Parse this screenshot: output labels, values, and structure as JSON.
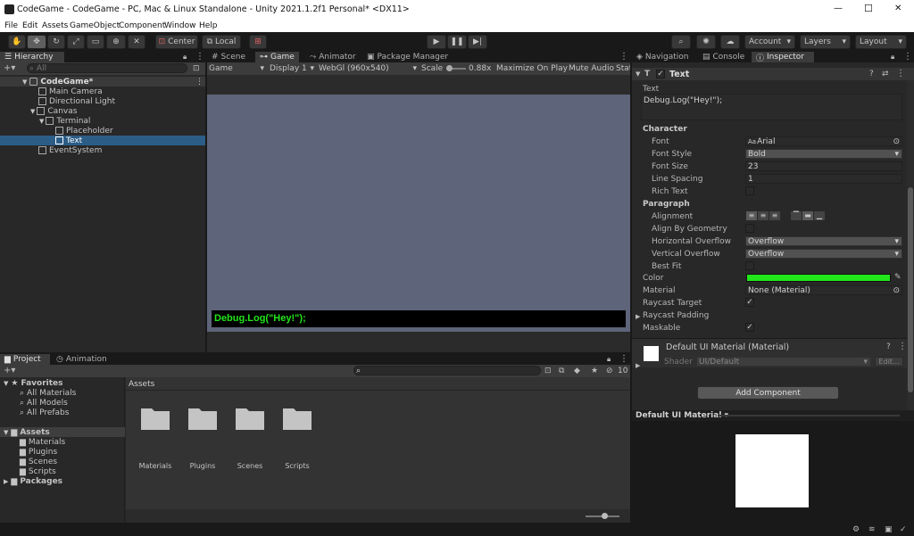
{
  "window": {
    "title": "CodeGame - CodeGame - PC, Mac & Linux Standalone - Unity 2021.1.2f1 Personal* <DX11>",
    "minimize": "—",
    "maximize": "☐",
    "close": "✕"
  },
  "menu": [
    "File",
    "Edit",
    "Assets",
    "GameObject",
    "Component",
    "Window",
    "Help"
  ],
  "toolbar": {
    "pivot_center": "Center",
    "pivot_local": "Local",
    "account": "Account",
    "layers": "Layers",
    "layout": "Layout"
  },
  "hierarchy": {
    "tab": "Hierarchy",
    "search_placeholder": "All",
    "items": [
      {
        "label": "CodeGame*"
      },
      {
        "label": "Main Camera"
      },
      {
        "label": "Directional Light"
      },
      {
        "label": "Canvas"
      },
      {
        "label": "Terminal"
      },
      {
        "label": "Placeholder"
      },
      {
        "label": "Text"
      },
      {
        "label": "EventSystem"
      }
    ]
  },
  "view_tabs": {
    "scene": "Scene",
    "game": "Game",
    "animator": "Animator",
    "package_manager": "Package Manager"
  },
  "game_toolbar": {
    "game": "Game",
    "display": "Display 1",
    "resolution": "WebGl (960x540)",
    "scale_label": "Scale",
    "scale_value": "0.88x",
    "maximize": "Maximize On Play",
    "mute": "Mute Audio",
    "stats": "Stat"
  },
  "game_view": {
    "terminal_text": "Debug.Log(\"Hey!\");"
  },
  "project": {
    "tab_project": "Project",
    "tab_animation": "Animation",
    "count": "10",
    "tree": {
      "favorites": "Favorites",
      "fav_items": [
        "All Materials",
        "All Models",
        "All Prefabs"
      ],
      "assets": "Assets",
      "asset_items": [
        "Materials",
        "Plugins",
        "Scenes",
        "Scripts"
      ],
      "packages": "Packages"
    },
    "breadcrumb": "Assets",
    "folders": [
      "Materials",
      "Plugins",
      "Scenes",
      "Scripts"
    ]
  },
  "inspector": {
    "tabs": {
      "navigation": "Navigation",
      "console": "Console",
      "inspector": "Inspector"
    },
    "component": "Text",
    "text_label": "Text",
    "text_value": "Debug.Log(\"Hey!\");",
    "character": "Character",
    "font_label": "Font",
    "font_value": "Arial",
    "font_style_label": "Font Style",
    "font_style_value": "Bold",
    "font_size_label": "Font Size",
    "font_size_value": "23",
    "line_spacing_label": "Line Spacing",
    "line_spacing_value": "1",
    "rich_text_label": "Rich Text",
    "paragraph": "Paragraph",
    "alignment_label": "Alignment",
    "align_geom_label": "Align By Geometry",
    "h_overflow_label": "Horizontal Overflow",
    "h_overflow_value": "Overflow",
    "v_overflow_label": "Vertical Overflow",
    "v_overflow_value": "Overflow",
    "best_fit_label": "Best Fit",
    "color_label": "Color",
    "color_value": "#22e61a",
    "material_label": "Material",
    "material_value": "None (Material)",
    "raycast_target_label": "Raycast Target",
    "raycast_padding_label": "Raycast Padding",
    "maskable_label": "Maskable",
    "default_material": "Default UI Material (Material)",
    "shader_label": "Shader",
    "shader_value": "UI/Default",
    "edit": "Edit...",
    "add_component": "Add Component",
    "preview_label": "Default UI Material"
  }
}
